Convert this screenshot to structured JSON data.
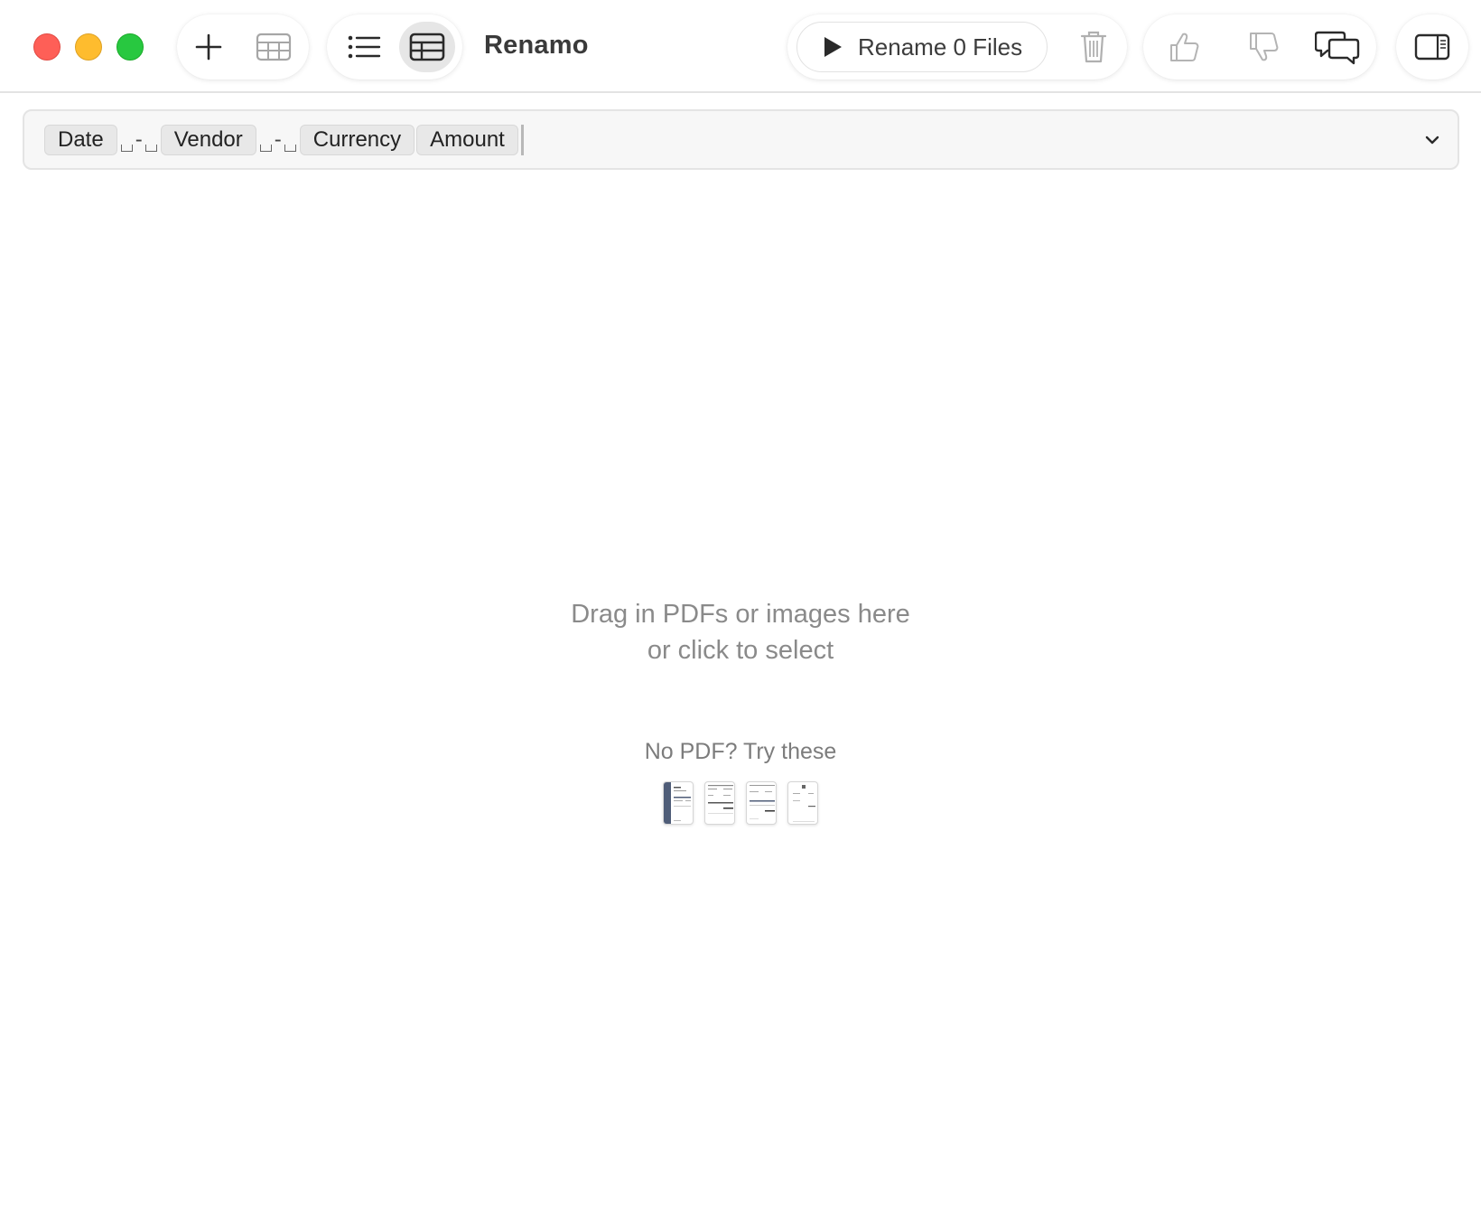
{
  "window": {
    "app_title": "Renamo",
    "traffic_lights": {
      "close": "#fe5f57",
      "minimize": "#febc2e",
      "zoom": "#28c840"
    }
  },
  "toolbar": {
    "add_icon": "plus-icon",
    "table_icon": "table-icon",
    "list_view_icon": "list-icon",
    "grid_view_icon": "grid-icon",
    "rename_button_label": "Rename 0 Files",
    "rename_icon": "play-icon",
    "trash_icon": "trash-icon",
    "thumbs_up_icon": "thumbs-up-icon",
    "thumbs_down_icon": "thumbs-down-icon",
    "feedback_icon": "chat-bubbles-icon",
    "sidebar_icon": "sidebar-icon"
  },
  "template": {
    "tokens": [
      "Date",
      "Vendor",
      "Currency",
      "Amount"
    ],
    "separator": "-",
    "dropdown_icon": "chevron-down-icon"
  },
  "dropzone": {
    "line1": "Drag in PDFs or images here",
    "line2": "or click to select",
    "samples_label": "No PDF? Try these",
    "sample_count": 4
  }
}
